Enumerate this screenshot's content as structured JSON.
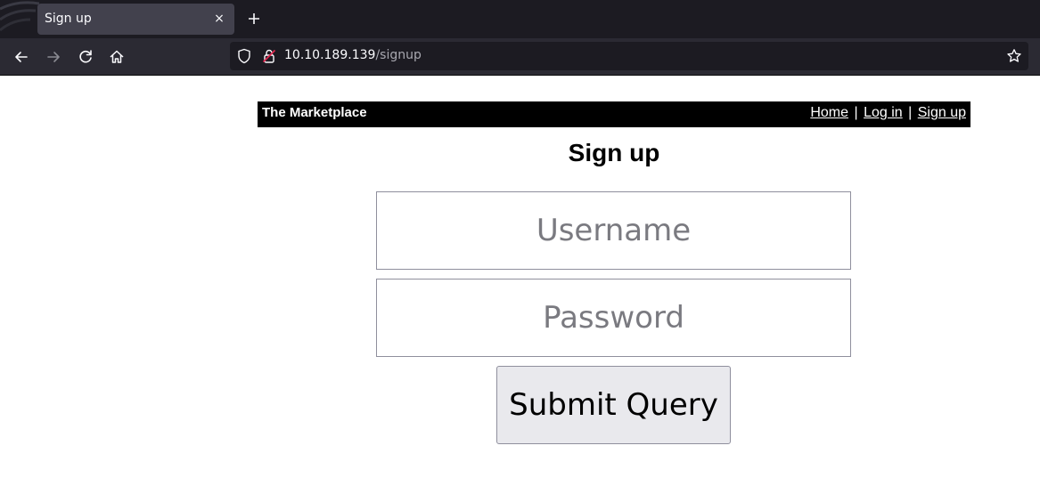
{
  "browser": {
    "tab_title": "Sign up",
    "close_symbol": "×",
    "url_host": "10.10.189.139",
    "url_path": "/signup",
    "icons": [
      "back-icon",
      "forward-icon",
      "reload-icon",
      "home-icon",
      "shield-icon",
      "insecure-lock-icon",
      "bookmark-star-icon",
      "new-tab-icon",
      "close-icon"
    ]
  },
  "site": {
    "brand": "The Marketplace",
    "nav": {
      "home": "Home",
      "login": "Log in",
      "signup": "Sign up",
      "separator": "|"
    }
  },
  "form": {
    "title": "Sign up",
    "username_placeholder": "Username",
    "password_placeholder": "Password",
    "username_value": "",
    "password_value": "",
    "submit_label": "Submit Query"
  },
  "colors": {
    "header_bg": "#000000",
    "chrome_dark": "#1c1b22",
    "tab_bg": "#42414d",
    "button_bg": "#e9e9ed"
  }
}
